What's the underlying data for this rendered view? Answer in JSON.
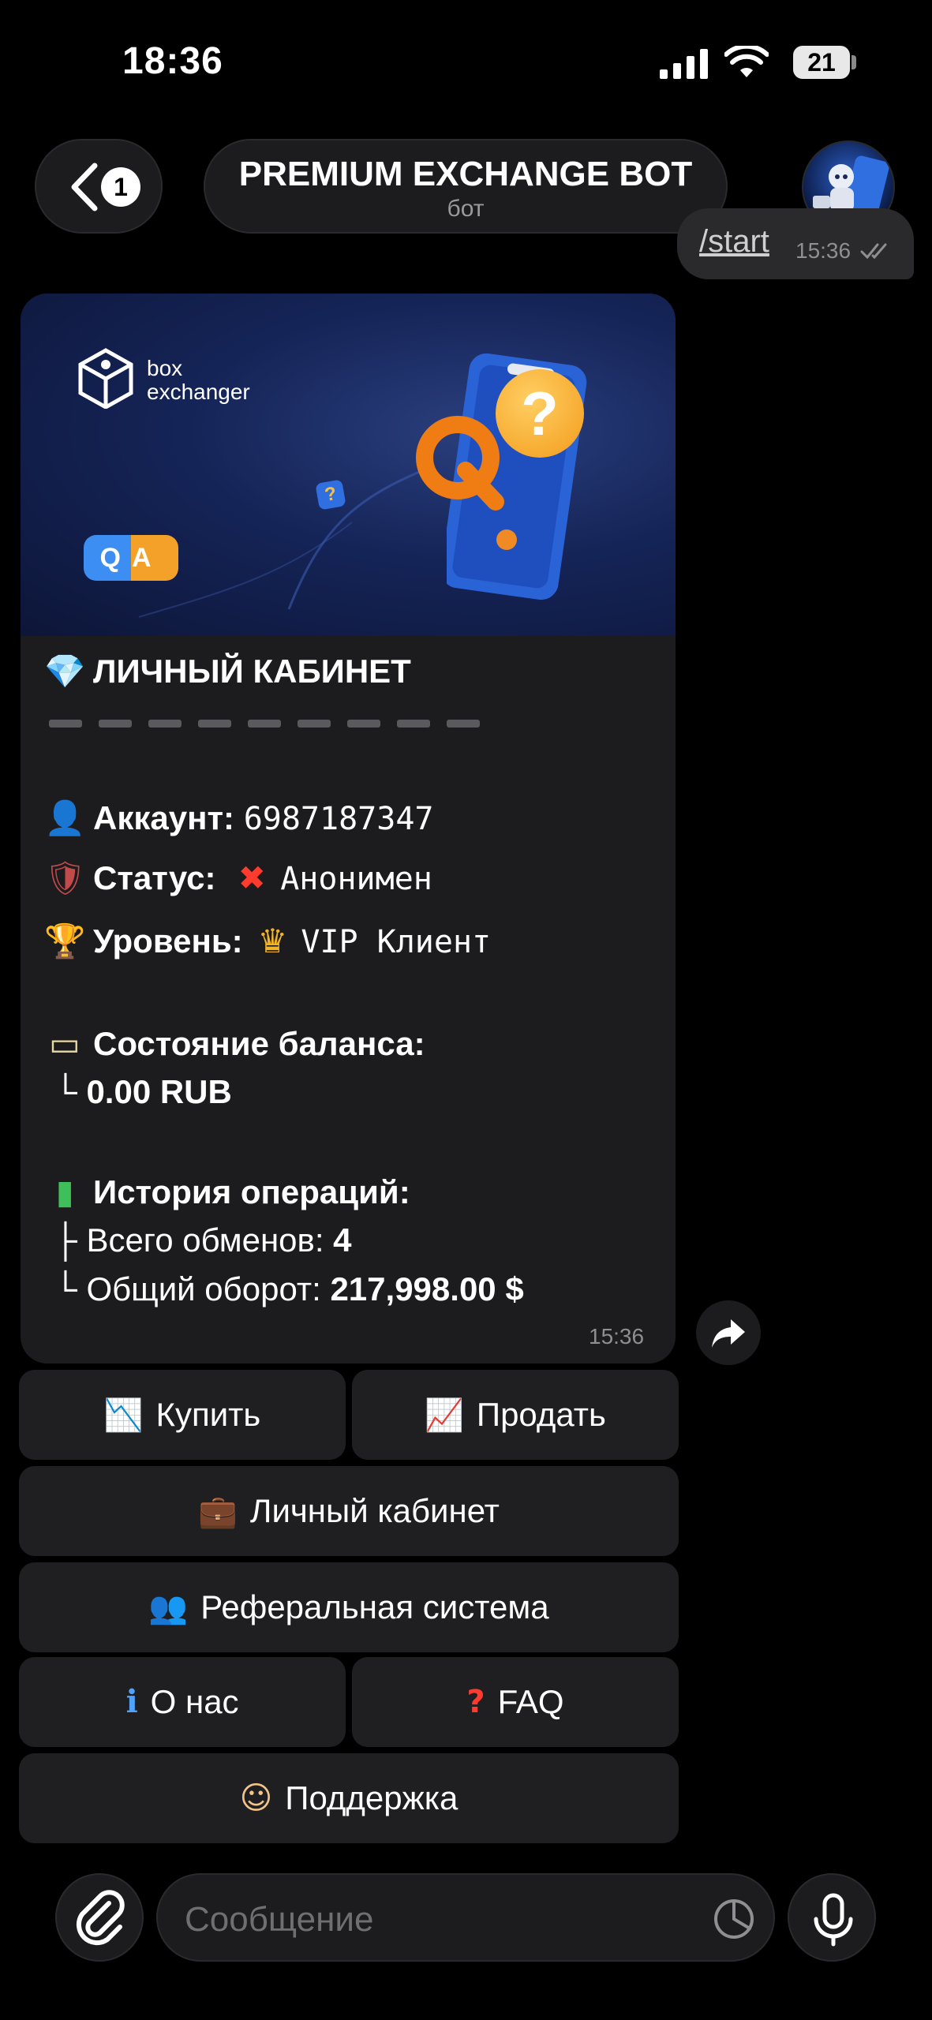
{
  "status_bar": {
    "time": "18:36",
    "battery": "21"
  },
  "header": {
    "back_badge": "1",
    "title": "PREMIUM EXCHANGE BOT",
    "subtitle": "бот"
  },
  "outgoing": {
    "text": "/start",
    "time": "15:36"
  },
  "banner": {
    "logo_line1": "box",
    "logo_line2": "exchanger",
    "qa_text": "QA",
    "question_mark": "?"
  },
  "message": {
    "heading": "ЛИЧНЫЙ КАБИНЕТ",
    "account_label": "Аккаунт:",
    "account_value": "6987187347",
    "status_label": "Статус:",
    "status_value": "Анонимен",
    "level_label": "Уровень:",
    "level_value": "VIP Клиент",
    "balance_label": "Состояние баланса:",
    "balance_prefix": "└",
    "balance_value": "0.00 RUB",
    "history_label": "История операций:",
    "exchanges_prefix": "├",
    "exchanges_label": "Всего обменов:",
    "exchanges_value": "4",
    "turnover_prefix": "└",
    "turnover_label": "Общий оборот:",
    "turnover_value": "217,998.00 $",
    "time": "15:36"
  },
  "keyboard": {
    "buy": "Купить",
    "sell": "Продать",
    "cabinet": "Личный кабинет",
    "referral": "Реферальная система",
    "about": "О нас",
    "faq": "FAQ",
    "support": "Поддержка"
  },
  "input": {
    "placeholder": "Сообщение"
  },
  "colors": {
    "background": "#000000",
    "bubble": "#1c1c1e",
    "button": "#1f1f21",
    "muted": "#8e8e93"
  },
  "icons": [
    "signal-icon",
    "wifi-icon",
    "battery-icon",
    "back-chevron-icon",
    "double-check-icon",
    "diamond-icon",
    "user-icon",
    "shield-icon",
    "cross-icon",
    "trophy-icon",
    "crown-icon",
    "card-icon",
    "bar-chart-icon",
    "chart-down-icon",
    "chart-up-icon",
    "briefcase-icon",
    "people-icon",
    "info-icon",
    "question-icon",
    "support-agent-icon",
    "share-icon",
    "paperclip-icon",
    "sticker-icon",
    "mic-icon"
  ]
}
